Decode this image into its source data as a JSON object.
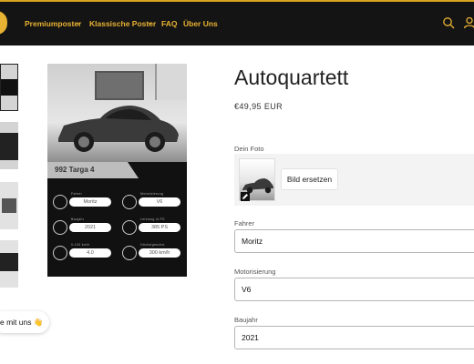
{
  "nav": {
    "items": [
      {
        "label": "Premiumposter",
        "has_dropdown": true
      },
      {
        "label": "Klassische Poster",
        "has_dropdown": true
      },
      {
        "label": "FAQ",
        "has_dropdown": false
      },
      {
        "label": "Über Uns",
        "has_dropdown": false
      }
    ],
    "accent_color": "#e8b233",
    "bar_color": "#141414"
  },
  "product": {
    "title": "Autoquartett",
    "price": "€49,95 EUR"
  },
  "card": {
    "model_title": "992 Targa 4",
    "stats": [
      {
        "label": "Fahrer",
        "value": "Moritz",
        "icon": "steering-wheel-icon"
      },
      {
        "label": "Motorisierung",
        "value": "V6",
        "icon": "engine-icon"
      },
      {
        "label": "Baujahr",
        "value": "2021",
        "icon": "calendar-icon"
      },
      {
        "label": "Leistung in PS",
        "value": "385 PS",
        "icon": "gear-icon"
      },
      {
        "label": "0-100 km/h",
        "value": "4.0",
        "icon": "timer-icon"
      },
      {
        "label": "Höchstgeschw.",
        "value": "300 km/h",
        "icon": "speedometer-icon"
      }
    ]
  },
  "form": {
    "photo_label": "Dein Foto",
    "replace_button": "Bild ersetzen",
    "driver_label": "Fahrer",
    "driver_value": "Moritz",
    "engine_label": "Motorisierung",
    "engine_value": "V6",
    "year_label": "Baujahr",
    "year_value": "2021"
  },
  "chat": {
    "label": "e mit uns",
    "emoji": "👋"
  }
}
